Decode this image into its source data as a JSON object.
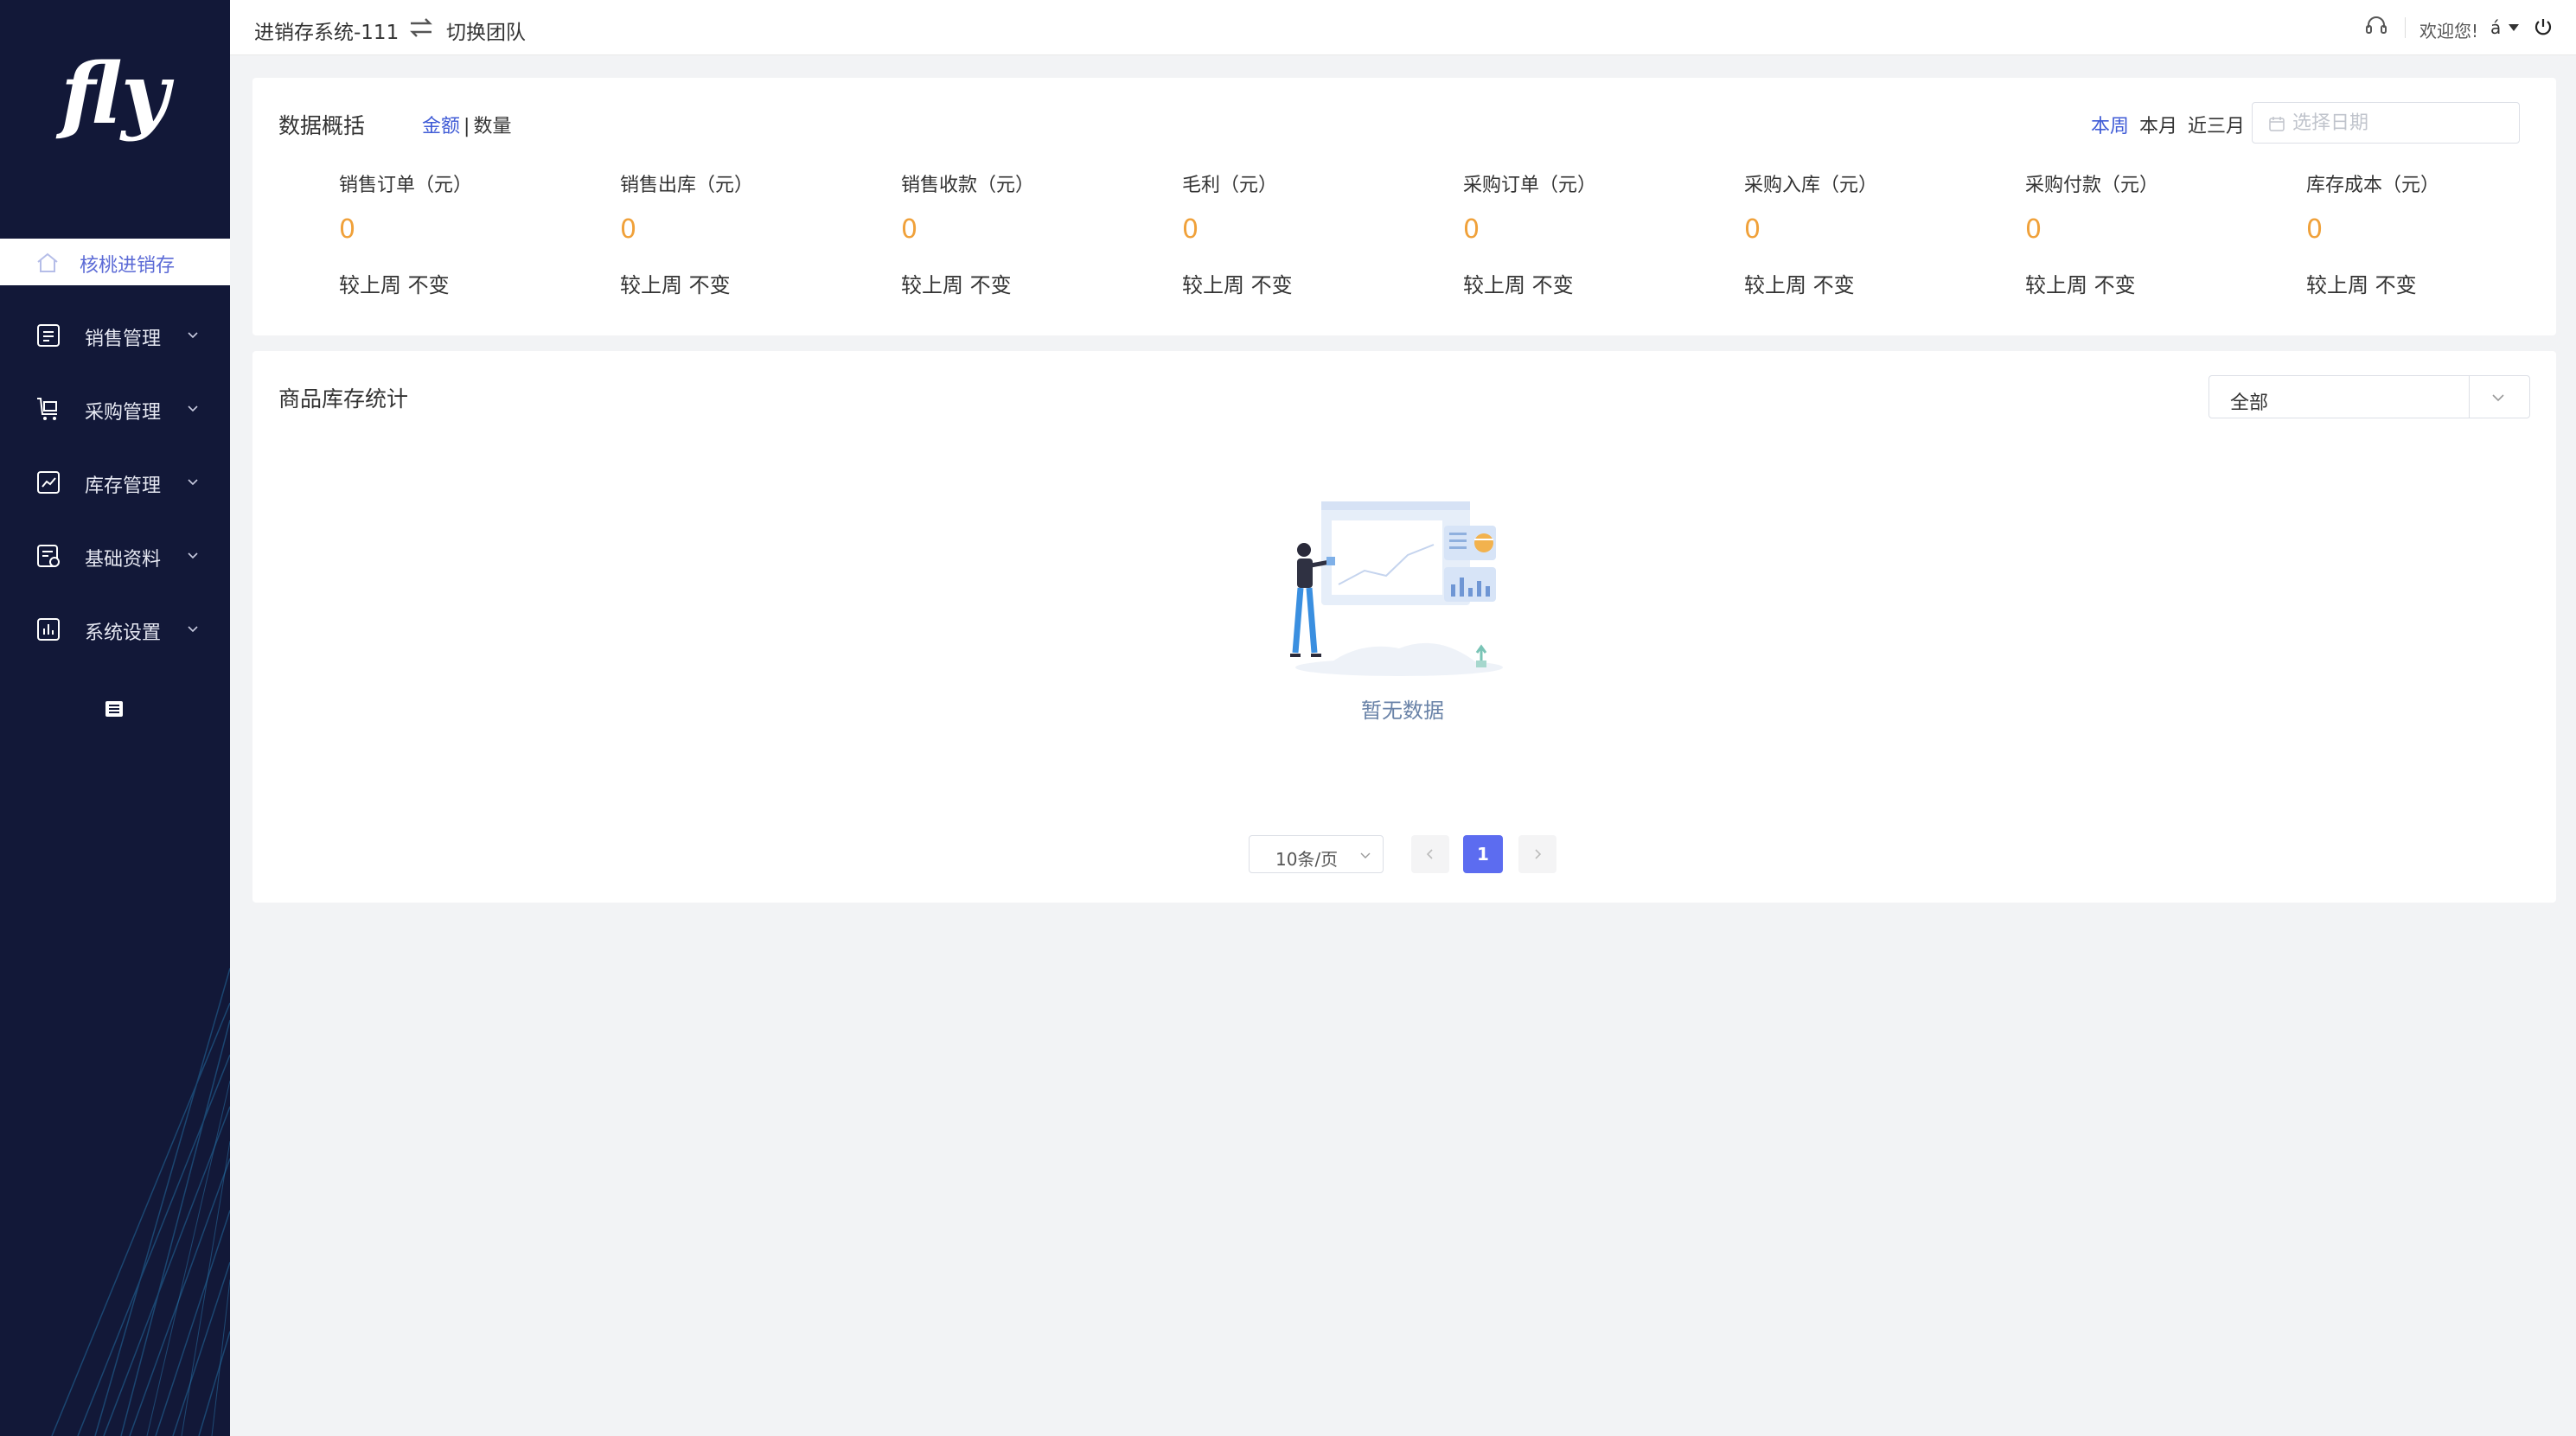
{
  "app": {
    "logo_text": "fly",
    "system_name": "进销存系统-111",
    "switch_team_label": "切换团队",
    "welcome": "欢迎您!",
    "user_name": "á"
  },
  "sidebar": {
    "home_label": "核桃进销存",
    "items": [
      {
        "label": "销售管理",
        "icon": "sales-icon"
      },
      {
        "label": "采购管理",
        "icon": "purchase-icon"
      },
      {
        "label": "库存管理",
        "icon": "inventory-icon"
      },
      {
        "label": "基础资料",
        "icon": "basic-data-icon"
      },
      {
        "label": "系统设置",
        "icon": "settings-icon"
      }
    ]
  },
  "overview": {
    "title": "数据概括",
    "toggle": {
      "active": "金额",
      "separator": "|",
      "inactive": "数量"
    },
    "ranges": [
      "本周",
      "本月",
      "近三月"
    ],
    "active_range": "本周",
    "date_placeholder": "选择日期",
    "metrics": [
      {
        "label": "销售订单（元）",
        "value": "0",
        "compare": "较上周 不变"
      },
      {
        "label": "销售出库（元）",
        "value": "0",
        "compare": "较上周 不变"
      },
      {
        "label": "销售收款（元）",
        "value": "0",
        "compare": "较上周 不变"
      },
      {
        "label": "毛利（元）",
        "value": "0",
        "compare": "较上周 不变"
      },
      {
        "label": "采购订单（元）",
        "value": "0",
        "compare": "较上周 不变"
      },
      {
        "label": "采购入库（元）",
        "value": "0",
        "compare": "较上周 不变"
      },
      {
        "label": "采购付款（元）",
        "value": "0",
        "compare": "较上周 不变"
      },
      {
        "label": "库存成本（元）",
        "value": "0",
        "compare": "较上周 不变"
      }
    ]
  },
  "stock": {
    "title": "商品库存统计",
    "filter_value": "全部",
    "empty_text": "暂无数据",
    "page_size": "10条/页",
    "current_page": "1"
  },
  "colors": {
    "sidebar_bg": "#121838",
    "accent": "#3f5bd6",
    "metric_value": "#f0a13a",
    "pager_active": "#5c6cf0"
  }
}
